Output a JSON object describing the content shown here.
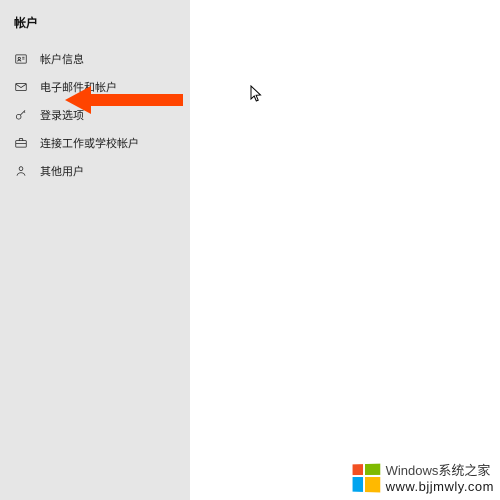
{
  "sidebar": {
    "title": "帐户",
    "items": [
      {
        "label": "帐户信息",
        "icon": "id-card-icon"
      },
      {
        "label": "电子邮件和帐户",
        "icon": "mail-icon"
      },
      {
        "label": "登录选项",
        "icon": "key-icon"
      },
      {
        "label": "连接工作或学校帐户",
        "icon": "briefcase-icon"
      },
      {
        "label": "其他用户",
        "icon": "person-icon"
      }
    ]
  },
  "annotation": {
    "arrow_target": "登录选项"
  },
  "watermark": {
    "brand": "Windows",
    "suffix": "系统之家",
    "url": "www.bjjmwly.com"
  }
}
